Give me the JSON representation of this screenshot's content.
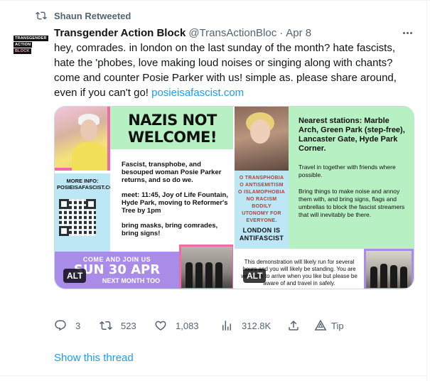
{
  "retweet": {
    "label": "Shaun Retweeted"
  },
  "author": {
    "name": "Transgender Action Block",
    "handle": "@TransActionBloc",
    "date": "Apr 8",
    "avatar_lines": [
      "TRANSGENDER",
      "ACTION",
      "BLOCK"
    ]
  },
  "tweet": {
    "text": "hey, comrades. in london on the last sunday of the month? hate fascists, hate the 'phobes, love making loud noises or singing along with chants? come and counter Posie Parker with us! simple as. please share around, even if you can't go!",
    "link": "posieisafascist.com"
  },
  "media": {
    "image1": {
      "title": "NAZIS NOT WELCOME!",
      "info": "MORE INFO: POSIEISAFASCIST.COM",
      "paragraphs": [
        "Fascist, transphobe, and besouped woman Posie Parker returns, and so do we.",
        "meet: 11:45, Joy of Life Fountain, Hyde Park, moving to Reformer's Tree by 1pm",
        "bring masks, bring comrades, bring signs!"
      ],
      "banner_top": "COME AND JOIN US",
      "banner_date": "SUN 30 APR",
      "banner_bottom": "NEXT MONTH TOO",
      "alt_label": "ALT"
    },
    "image2": {
      "heading": "Nearest stations: Marble Arch, Green Park (step-free), Lancaster Gate, Hyde Park Corner.",
      "text1": "Travel in together with friends where possible.",
      "text2": "Bring things to make noise and annoy them with, and bring signs, flags and umbrellas to block the fascist streamers that will inevitably be there.",
      "side_lines": [
        "O TRANSPHOBIA",
        "O ANTISEMITISM",
        "O ISLAMOPHOBIA",
        "NO RACISM",
        "BODILY",
        "UTONOMY FOR",
        "EVERYONE."
      ],
      "side_footer": "LONDON IS ANTIFASCIST",
      "bottom_text": "This demonstration will likely run for several hours and you will likely be standing. You are welcome to arrive when you like but please be aware of and travel in safely.",
      "alt_label": "ALT"
    }
  },
  "actions": {
    "replies": "3",
    "retweets": "523",
    "likes": "1,083",
    "views": "312.8K",
    "tip": "Tip"
  },
  "show_thread": "Show this thread",
  "icons": [
    "retweet-icon",
    "more-icon",
    "reply-icon",
    "retweet-icon",
    "like-icon",
    "views-icon",
    "share-icon",
    "tip-icon"
  ],
  "colors": {
    "link": "#1d9bf0",
    "muted": "#536471",
    "text": "#0f1419",
    "pink": "#f06aa8",
    "green": "#b7f0c3",
    "blue": "#bde7f5",
    "purple": "#a98ce8"
  }
}
